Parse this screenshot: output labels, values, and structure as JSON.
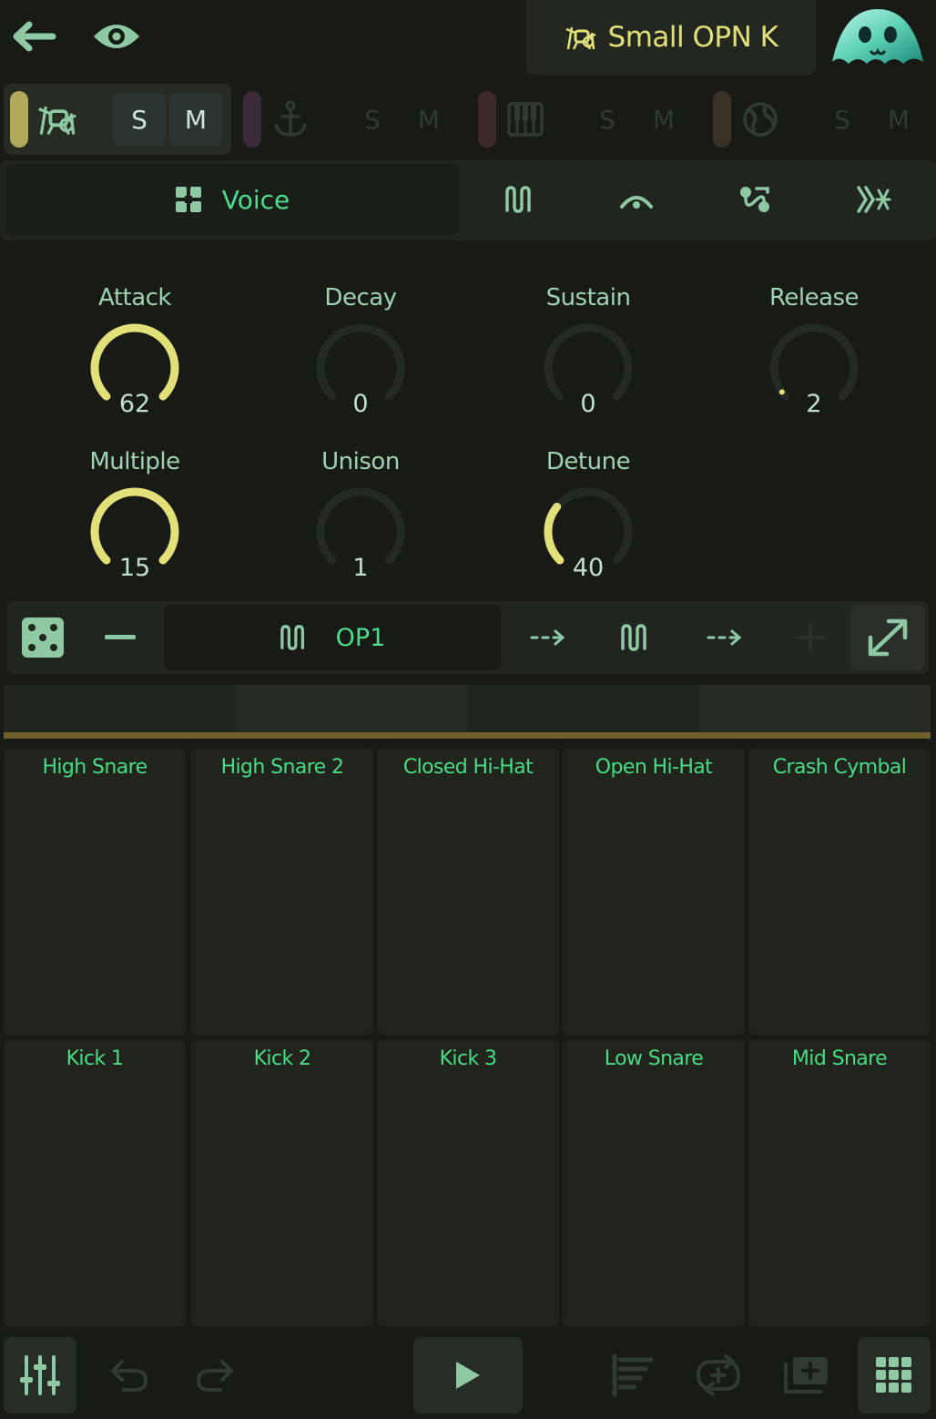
{
  "header": {
    "back_icon": "arrow-left-icon",
    "visibility_icon": "eye-icon",
    "instrument_name": "Small OPN K",
    "instrument_icon": "drum-kit-icon",
    "avatar_icon": "ghost-mascot-icon"
  },
  "tracks": [
    {
      "icon": "drum-kit-icon",
      "color": "#b3a95a",
      "solo": "S",
      "mute": "M",
      "active": true
    },
    {
      "icon": "anchor-icon",
      "color": "#3a2a3a",
      "solo": "S",
      "mute": "M",
      "active": false
    },
    {
      "icon": "piano-icon",
      "color": "#3d2a28",
      "solo": "S",
      "mute": "M",
      "active": false
    },
    {
      "icon": "globe-icon",
      "color": "#3b3226",
      "solo": "S",
      "mute": "M",
      "active": false
    }
  ],
  "tabs": {
    "voice_label": "Voice",
    "voice_icon": "grid-blocks-icon",
    "others": [
      "waveform-icon",
      "arc-icon",
      "modulation-icon",
      "effects-icon"
    ]
  },
  "knobs": {
    "attack": {
      "label": "Attack",
      "value": "62",
      "fraction": 1.0
    },
    "decay": {
      "label": "Decay",
      "value": "0",
      "fraction": 0.0
    },
    "sustain": {
      "label": "Sustain",
      "value": "0",
      "fraction": 0.0
    },
    "release": {
      "label": "Release",
      "value": "2",
      "fraction": 0.03
    },
    "multiple": {
      "label": "Multiple",
      "value": "15",
      "fraction": 1.0
    },
    "unison": {
      "label": "Unison",
      "value": "1",
      "fraction": 0.0
    },
    "detune": {
      "label": "Detune",
      "value": "40",
      "fraction": 0.31
    }
  },
  "operators": {
    "selected_label": "OP1",
    "dice_icon": "dice-icon",
    "remove_icon": "minus-icon",
    "add_icon": "plus-icon",
    "expand_icon": "expand-icon"
  },
  "pads": [
    "High Snare",
    "High Snare 2",
    "Closed Hi-Hat",
    "Open Hi-Hat",
    "Crash Cymbal",
    "Kick 1",
    "Kick 2",
    "Kick 3",
    "Low Snare",
    "Mid Snare"
  ],
  "toolbar": [
    "mixer-icon",
    "undo-icon",
    "redo-icon",
    "play-icon",
    "sequencer-icon",
    "loop-icon",
    "add-pattern-icon",
    "pad-grid-icon"
  ],
  "colors": {
    "accent_green": "#4fdc8a",
    "accent_yellow": "#e3e07a",
    "background": "#171a15"
  }
}
